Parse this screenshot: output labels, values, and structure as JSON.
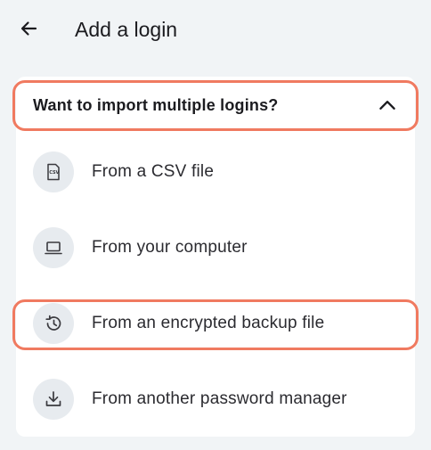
{
  "header": {
    "title": "Add a login"
  },
  "import_section": {
    "heading": "Want to import multiple logins?",
    "expanded": true,
    "options": [
      {
        "label": "From a CSV file",
        "icon": "csv-file-icon"
      },
      {
        "label": "From your computer",
        "icon": "laptop-icon"
      },
      {
        "label": "From an encrypted backup file",
        "icon": "restore-backup-icon"
      },
      {
        "label": "From another password manager",
        "icon": "download-icon"
      }
    ],
    "csv_icon_text": "CSV"
  },
  "colors": {
    "background": "#f1f4f6",
    "card": "#ffffff",
    "highlight": "#f07a60",
    "icon_bg": "#e7ebef"
  }
}
